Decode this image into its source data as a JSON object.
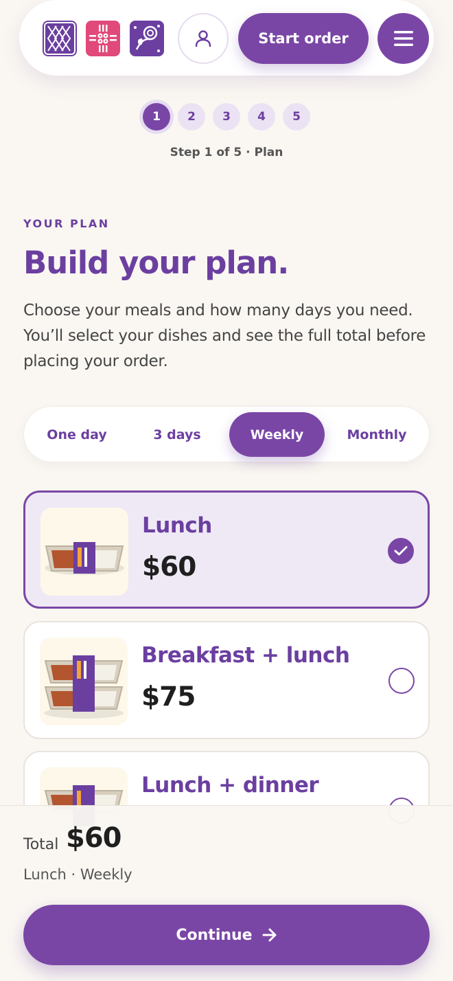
{
  "header": {
    "logos": [
      "logo-xx-icon",
      "logo-flower-grid-icon",
      "logo-rose-icon"
    ],
    "account_icon": "person-icon",
    "start_order_label": "Start order",
    "menu_icon": "hamburger-icon"
  },
  "stepper": {
    "steps": [
      "1",
      "2",
      "3",
      "4",
      "5"
    ],
    "active": 1,
    "caption": "Step 1 of 5 · Plan"
  },
  "intro": {
    "eyebrow": "YOUR PLAN",
    "title": "Build your plan.",
    "lead": "Choose your meals and how many days you need. You’ll select your dishes and see the full total before placing your order."
  },
  "durations": {
    "options": [
      "One day",
      "3 days",
      "Weekly",
      "Monthly"
    ],
    "selected": "Weekly"
  },
  "plans": [
    {
      "name": "Lunch",
      "price": "$60",
      "selected": true
    },
    {
      "name": "Breakfast + lunch",
      "price": "$75",
      "selected": false
    },
    {
      "name": "Lunch + dinner",
      "price": "",
      "selected": false
    }
  ],
  "summary": {
    "total_label": "Total",
    "total_value": "$60",
    "selection": "Lunch · Weekly",
    "continue_label": "Continue",
    "continue_icon": "arrow-right-icon"
  },
  "colors": {
    "brand_purple": "#7a46a6",
    "brand_pink": "#e0497a",
    "background": "#faf7f2"
  }
}
